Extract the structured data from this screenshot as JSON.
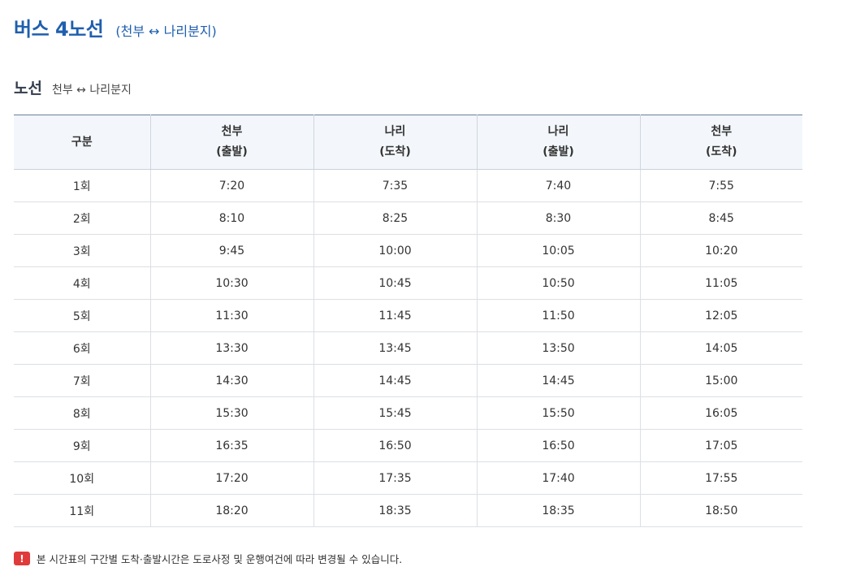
{
  "page": {
    "title": "버스 4노선",
    "subtitle": "(천부 ↔ 나리분지)"
  },
  "section": {
    "title": "노선",
    "subtitle": "천부 ↔ 나리분지"
  },
  "table": {
    "headers": [
      {
        "line1": "구분",
        "line2": ""
      },
      {
        "line1": "천부",
        "line2": "(출발)"
      },
      {
        "line1": "나리",
        "line2": "(도착)"
      },
      {
        "line1": "나리",
        "line2": "(출발)"
      },
      {
        "line1": "천부",
        "line2": "(도착)"
      }
    ],
    "rows": [
      [
        "1회",
        "7:20",
        "7:35",
        "7:40",
        "7:55"
      ],
      [
        "2회",
        "8:10",
        "8:25",
        "8:30",
        "8:45"
      ],
      [
        "3회",
        "9:45",
        "10:00",
        "10:05",
        "10:20"
      ],
      [
        "4회",
        "10:30",
        "10:45",
        "10:50",
        "11:05"
      ],
      [
        "5회",
        "11:30",
        "11:45",
        "11:50",
        "12:05"
      ],
      [
        "6회",
        "13:30",
        "13:45",
        "13:50",
        "14:05"
      ],
      [
        "7회",
        "14:30",
        "14:45",
        "14:45",
        "15:00"
      ],
      [
        "8회",
        "15:30",
        "15:45",
        "15:50",
        "16:05"
      ],
      [
        "9회",
        "16:35",
        "16:50",
        "16:50",
        "17:05"
      ],
      [
        "10회",
        "17:20",
        "17:35",
        "17:40",
        "17:55"
      ],
      [
        "11회",
        "18:20",
        "18:35",
        "18:35",
        "18:50"
      ]
    ]
  },
  "notice": {
    "icon": "exclamation-icon",
    "icon_glyph": "!",
    "icon_color": "#e03a3a",
    "text": "본 시간표의 구간별 도착·출발시간은 도로사정 및 운행여건에 따라 변경될 수 있습니다."
  },
  "colors": {
    "title": "#1f5fae",
    "header_bg": "#f3f7fb"
  }
}
